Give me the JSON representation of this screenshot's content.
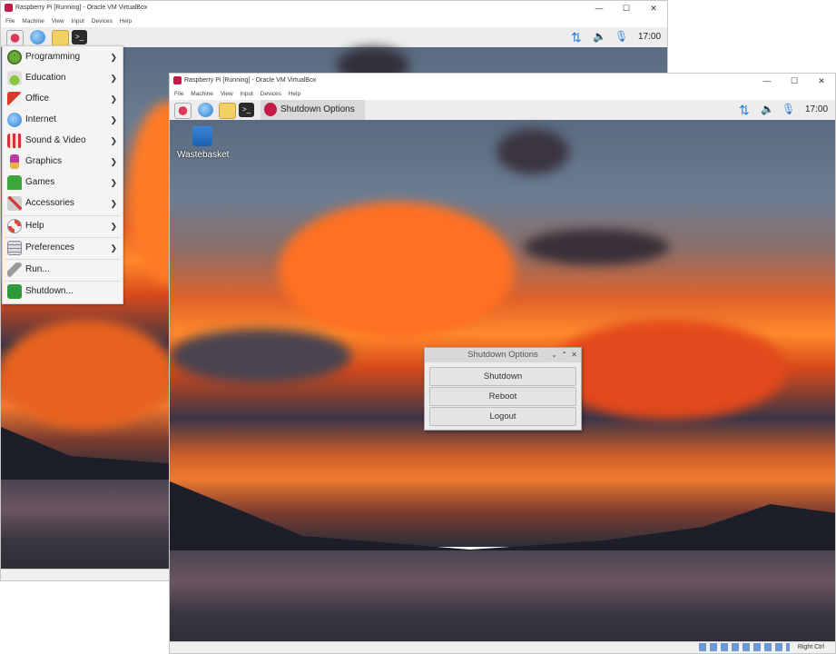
{
  "back_window": {
    "title": "Raspberry Pi [Running] - Oracle VM VirtualBox",
    "menus": [
      "File",
      "Machine",
      "View",
      "Input",
      "Devices",
      "Help"
    ],
    "clock": "17:00",
    "start_menu": {
      "items": [
        {
          "label": "Programming",
          "icon": "programming-icon",
          "submenu": true
        },
        {
          "label": "Education",
          "icon": "education-icon",
          "submenu": true
        },
        {
          "label": "Office",
          "icon": "office-icon",
          "submenu": true
        },
        {
          "label": "Internet",
          "icon": "internet-icon",
          "submenu": true
        },
        {
          "label": "Sound & Video",
          "icon": "sound-video-icon",
          "submenu": true
        },
        {
          "label": "Graphics",
          "icon": "graphics-icon",
          "submenu": true
        },
        {
          "label": "Games",
          "icon": "games-icon",
          "submenu": true
        },
        {
          "label": "Accessories",
          "icon": "accessories-icon",
          "submenu": true
        },
        {
          "label": "Help",
          "icon": "help-icon",
          "submenu": true
        },
        {
          "label": "Preferences",
          "icon": "preferences-icon",
          "submenu": true
        },
        {
          "label": "Run...",
          "icon": "run-icon",
          "submenu": false
        },
        {
          "label": "Shutdown...",
          "icon": "shutdown-icon",
          "submenu": false
        }
      ]
    }
  },
  "front_window": {
    "title": "Raspberry Pi [Running] - Oracle VM VirtualBox",
    "menus": [
      "File",
      "Machine",
      "View",
      "Input",
      "Devices",
      "Help"
    ],
    "taskbar_task": "Shutdown Options",
    "clock": "17:00",
    "desktop_icon": "Wastebasket",
    "host_key": "Right Ctrl"
  },
  "dialog": {
    "title": "Shutdown Options",
    "buttons": [
      "Shutdown",
      "Reboot",
      "Logout"
    ]
  },
  "colors": {
    "raspberry": "#c51a4a",
    "tray_blue": "#2a7fd4"
  }
}
